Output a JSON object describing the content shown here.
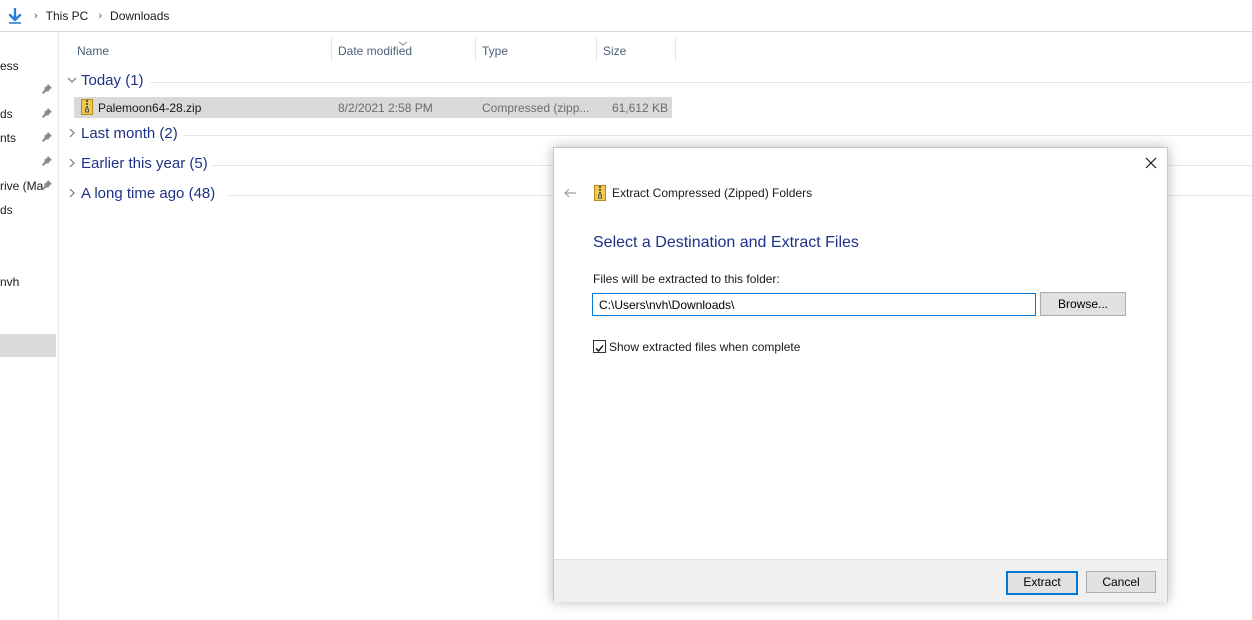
{
  "address_bar": {
    "crumbs": [
      "This PC",
      "Downloads"
    ]
  },
  "nav_pane": {
    "items": [
      {
        "label": "ess",
        "pinned": false
      },
      {
        "label": "",
        "pinned": true
      },
      {
        "label": "ds",
        "pinned": true
      },
      {
        "label": "nts",
        "pinned": true
      },
      {
        "label": "",
        "pinned": true
      },
      {
        "label": "rive (Ma",
        "pinned": true
      },
      {
        "label": "ds",
        "pinned": false
      },
      {
        "label": "nvh",
        "pinned": false
      }
    ]
  },
  "columns": {
    "name": "Name",
    "date_modified": "Date modified",
    "type": "Type",
    "size": "Size"
  },
  "groups": [
    {
      "label": "Today (1)",
      "expanded": true
    },
    {
      "label": "Last month (2)",
      "expanded": false
    },
    {
      "label": "Earlier this year (5)",
      "expanded": false
    },
    {
      "label": "A long time ago (48)",
      "expanded": false
    }
  ],
  "files": [
    {
      "name": "Palemoon64-28.zip",
      "date": "8/2/2021 2:58 PM",
      "type": "Compressed (zipp...",
      "size": "61,612 KB"
    }
  ],
  "dialog": {
    "title": "Extract Compressed (Zipped) Folders",
    "heading": "Select a Destination and Extract Files",
    "field_label": "Files will be extracted to this folder:",
    "path": "C:\\Users\\nvh\\Downloads\\",
    "browse_label": "Browse...",
    "checkbox_label": "Show extracted files when complete",
    "checkbox_checked": true,
    "extract_label": "Extract",
    "cancel_label": "Cancel"
  },
  "colors": {
    "accent": "#0078d7",
    "group_text": "#1e3287",
    "selection": "#d9d9d9"
  }
}
